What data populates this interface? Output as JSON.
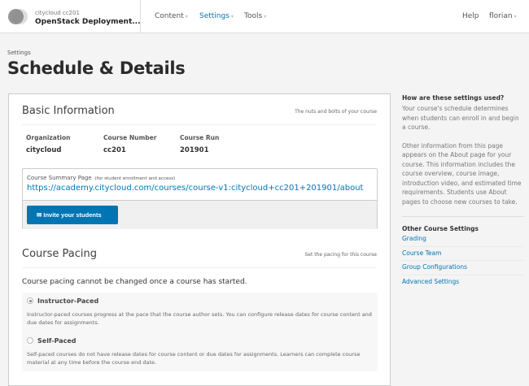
{
  "header": {
    "course_org": "citycloud cc201",
    "course_name": "OpenStack Deployment...",
    "nav": [
      {
        "label": "Content"
      },
      {
        "label": "Settings"
      },
      {
        "label": "Tools"
      }
    ],
    "help": "Help",
    "user": "florian"
  },
  "page": {
    "breadcrumb": "Settings",
    "title": "Schedule & Details"
  },
  "basic": {
    "title": "Basic Information",
    "subtitle": "The nuts and bolts of your course",
    "fields": [
      {
        "label": "Organization",
        "value": "citycloud"
      },
      {
        "label": "Course Number",
        "value": "cc201"
      },
      {
        "label": "Course Run",
        "value": "201901"
      }
    ],
    "summary_label": "Course Summary Page",
    "summary_hint": "(for student enrollment and access)",
    "summary_url": "https://academy.citycloud.com/courses/course-v1:citycloud+cc201+201901/about",
    "invite_label": "Invite your students"
  },
  "pacing": {
    "title": "Course Pacing",
    "subtitle": "Set the pacing for this course",
    "note": "Course pacing cannot be changed once a course has started.",
    "options": [
      {
        "label": "Instructor-Paced",
        "desc": "Instructor-paced courses progress at the pace that the course author sets. You can configure release dates for course content and due dates for assignments.",
        "selected": true
      },
      {
        "label": "Self-Paced",
        "desc": "Self-paced courses do not have release dates for course content or due dates for assignments. Learners can complete course material at any time before the course end date.",
        "selected": false
      }
    ]
  },
  "sidebar": {
    "heading": "How are these settings used?",
    "p1": "Your course's schedule determines when students can enroll in and begin a course.",
    "p2": "Other information from this page appears on the About page for your course. This information includes the course overview, course image, introduction video, and estimated time requirements. Students use About pages to choose new courses to take.",
    "other_heading": "Other Course Settings",
    "links": [
      {
        "label": "Grading"
      },
      {
        "label": "Course Team"
      },
      {
        "label": "Group Configurations"
      },
      {
        "label": "Advanced Settings"
      }
    ]
  },
  "colors": {
    "accent": "#0075b4"
  }
}
